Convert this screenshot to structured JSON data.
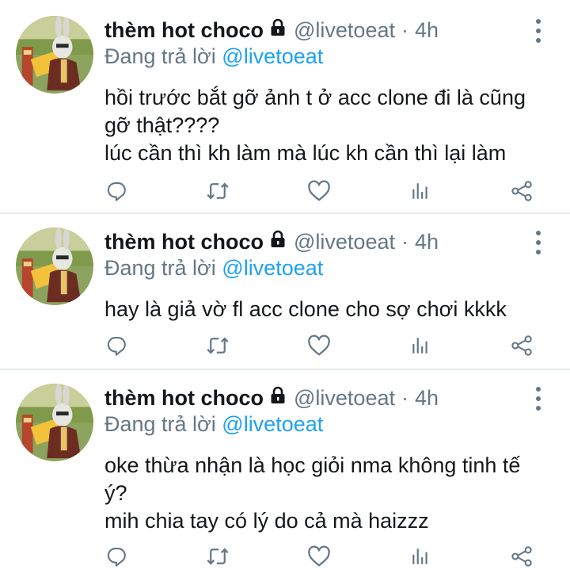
{
  "colors": {
    "accent": "#1da1f2",
    "secondary": "#657786",
    "text": "#14171a",
    "divider": "#e6ecf0"
  },
  "tweets": [
    {
      "author_name": "thèm hot choco",
      "author_handle": "@livetoeat",
      "separator": "·",
      "time": "4h",
      "reply_prefix": "Đang trả lời",
      "reply_handle": "@livetoeat",
      "lines": [
        "hồi trước bắt gỡ ảnh t ở acc clone đi là cũng",
        "gỡ thật????",
        "lúc cần thì kh làm mà lúc kh cần thì lại làm"
      ]
    },
    {
      "author_name": "thèm hot choco",
      "author_handle": "@livetoeat",
      "separator": "·",
      "time": "4h",
      "reply_prefix": "Đang trả lời",
      "reply_handle": "@livetoeat",
      "lines": [
        "hay là giả vờ fl acc clone cho sợ chơi kkkk"
      ]
    },
    {
      "author_name": "thèm hot choco",
      "author_handle": "@livetoeat",
      "separator": "·",
      "time": "4h",
      "reply_prefix": "Đang trả lời",
      "reply_handle": "@livetoeat",
      "lines": [
        "oke thừa nhận là học giỏi nma không tinh tế",
        "ý?",
        "mih chia tay có lý do cả mà haizzz"
      ]
    }
  ],
  "icons": {
    "lock": "lock-icon",
    "more": "more-vertical-icon",
    "reply": "reply-icon",
    "retweet": "retweet-icon",
    "like": "heart-icon",
    "analytics": "analytics-icon",
    "share": "share-icon"
  }
}
